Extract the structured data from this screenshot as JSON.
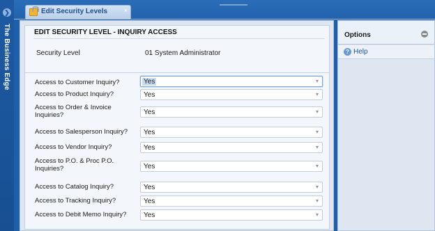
{
  "app": {
    "brand": "The Business Edge",
    "collapse_glyph": "❯"
  },
  "tabs": [
    {
      "label": "Edit Security Levels",
      "close": "×",
      "icon": "folder-key-icon"
    }
  ],
  "header": {
    "section_title": "EDIT SECURITY LEVEL - INQUIRY ACCESS",
    "security_level_label": "Security Level",
    "security_level_value": "01 System Administrator"
  },
  "form": {
    "rows": [
      {
        "label": "Access to Customer Inquiry?",
        "value": "Yes"
      },
      {
        "label": "Access to Product Inquiry?",
        "value": "Yes"
      },
      {
        "label": "Access to Order & Invoice Inquiries?",
        "value": "Yes"
      },
      {
        "label": "Access to Salesperson Inquiry?",
        "value": "Yes"
      },
      {
        "label": "Access to Vendor Inquiry?",
        "value": "Yes"
      },
      {
        "label": "Access to P.O. & Proc P.O. Inquiries?",
        "value": "Yes"
      },
      {
        "label": "Access to Catalog Inquiry?",
        "value": "Yes"
      },
      {
        "label": "Access to Tracking Inquiry?",
        "value": "Yes"
      },
      {
        "label": "Access to Debit Memo Inquiry?",
        "value": "Yes"
      }
    ],
    "arrow_glyph": "▾"
  },
  "options": {
    "title": "Options",
    "items": [
      {
        "label": "Help",
        "icon": "help-icon",
        "icon_glyph": "?"
      }
    ]
  },
  "colors": {
    "frame_blue": "#1f5fa8",
    "panel_bg": "#dde6f1",
    "selection": "#c9dbf2"
  }
}
